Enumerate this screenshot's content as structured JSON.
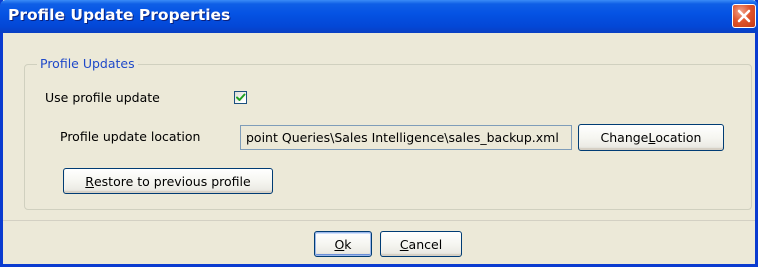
{
  "window": {
    "title": "Profile Update Properties",
    "close_icon": "close-icon",
    "accent": "#0553e4"
  },
  "group": {
    "label": "Profile Updates",
    "label_color": "#1f49c9"
  },
  "use_profile_update": {
    "label": "Use profile update",
    "checked": true
  },
  "location": {
    "label": "Profile update location",
    "value": "point Queries\\Sales Intelligence\\sales_backup.xml",
    "change_button": {
      "pre": "Change ",
      "mnemonic": "L",
      "post": "ocation"
    }
  },
  "restore_button": {
    "pre": "",
    "mnemonic": "R",
    "post": "estore to previous profile"
  },
  "ok_button": {
    "pre": "",
    "mnemonic": "O",
    "post": "k"
  },
  "cancel_button": {
    "pre": "",
    "mnemonic": "C",
    "post": "ancel"
  }
}
